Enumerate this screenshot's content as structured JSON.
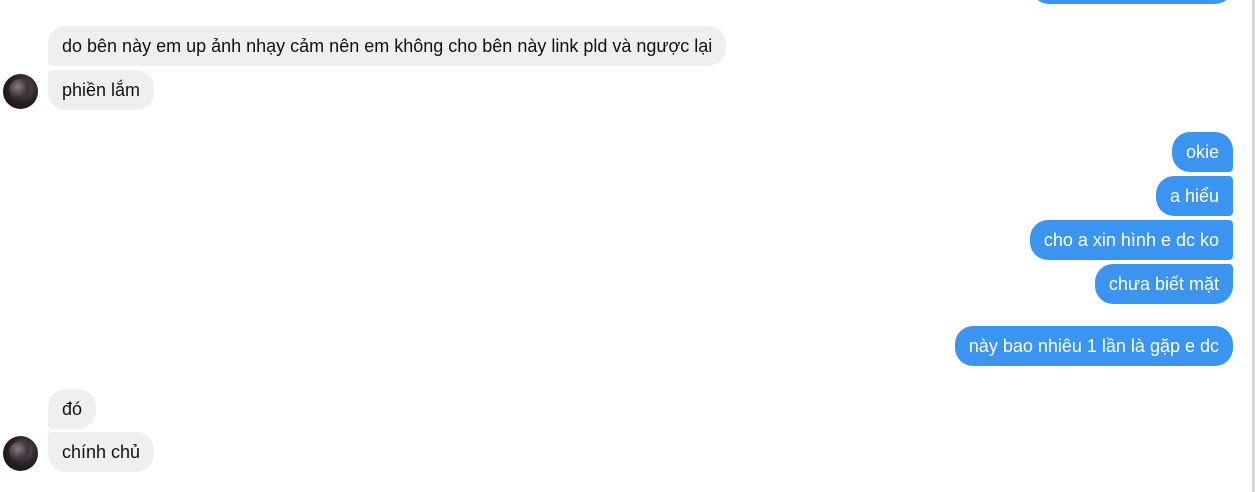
{
  "conversation": {
    "messages": [
      {
        "sender": "contact",
        "text": ""
      },
      {
        "sender": "contact",
        "text": "do bên này em up ảnh nhạy cảm nên em không cho bên này link pld và ngược lại"
      },
      {
        "sender": "contact",
        "text": "phiền lắm"
      },
      {
        "sender": "me",
        "text": "okie"
      },
      {
        "sender": "me",
        "text": "a hiểu"
      },
      {
        "sender": "me",
        "text": "cho a xin hình e dc ko"
      },
      {
        "sender": "me",
        "text": "chưa biết mặt"
      },
      {
        "sender": "me",
        "text": "này bao nhiêu 1 lần là gặp e dc"
      },
      {
        "sender": "contact",
        "text": "đó"
      },
      {
        "sender": "contact",
        "text": "chính chủ"
      }
    ]
  },
  "colors": {
    "outgoing_bubble": "#3b95f0",
    "incoming_bubble": "#efefef",
    "outgoing_text": "#ffffff",
    "incoming_text": "#111111"
  },
  "icons": {
    "contact_avatar": "avatar-icon"
  }
}
